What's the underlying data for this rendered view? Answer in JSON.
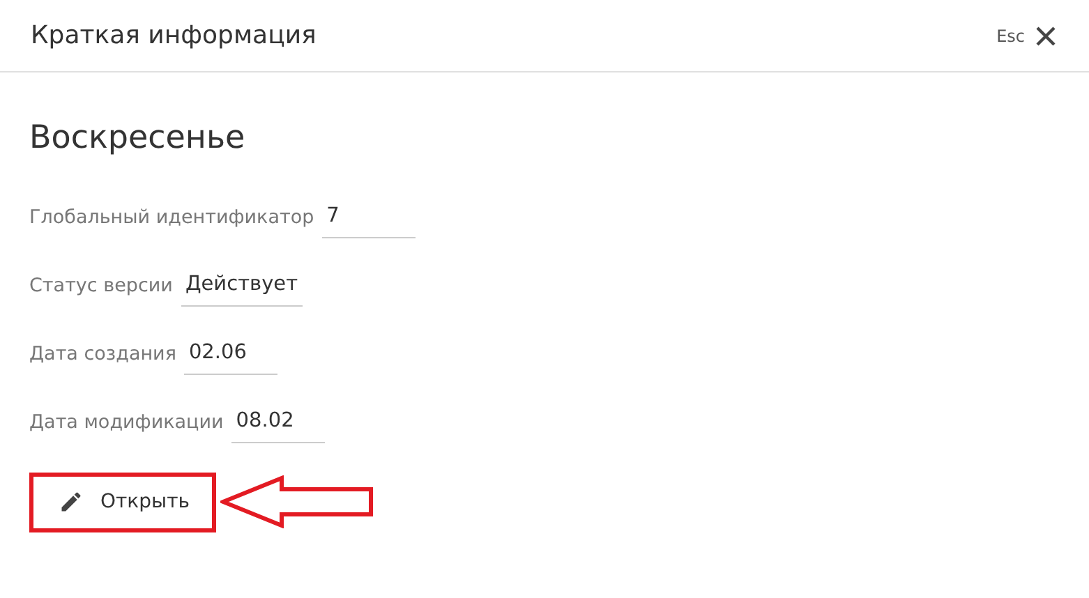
{
  "panel": {
    "title": "Краткая информация",
    "close_hint": "Esc"
  },
  "heading": "Воскресенье",
  "fields": [
    {
      "label": "Глобальный идентификатор",
      "value": "7"
    },
    {
      "label": "Статус версии",
      "value": "Действует"
    },
    {
      "label": "Дата создания",
      "value": "02.06"
    },
    {
      "label": "Дата модификации",
      "value": "08.02"
    }
  ],
  "button": {
    "label": "Открыть",
    "highlighted": true
  }
}
